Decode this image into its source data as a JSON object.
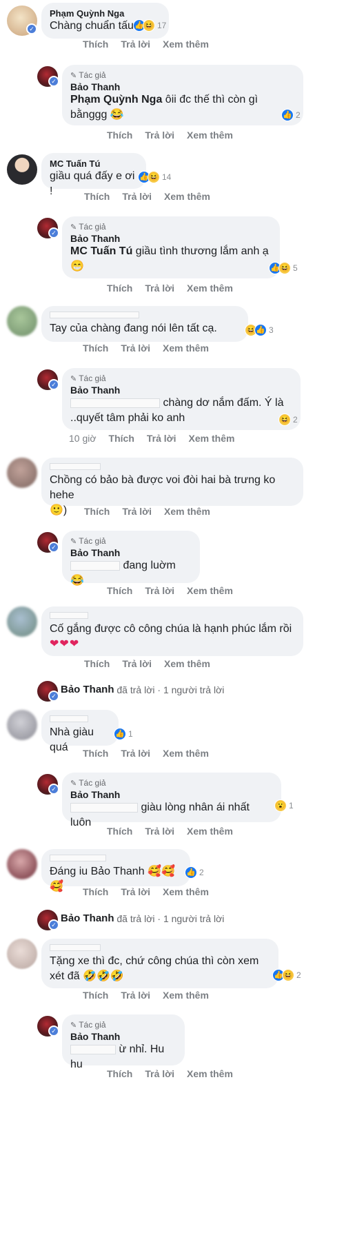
{
  "labels": {
    "like": "Thích",
    "reply": "Trả lời",
    "more": "Xem thêm",
    "author": "Tác giả",
    "replied_suffix": "đã trả lời",
    "one_reply": "1 người trả lời"
  },
  "comments": [
    {
      "name": "Phạm Quỳnh Nga",
      "text": "Chàng chuẩn tấu",
      "react_count": "17"
    },
    {
      "name": "Bảo Thanh",
      "tag": "Phạm Quỳnh Nga",
      "text": " ôii đc thế thì còn gì bằnggg",
      "react_count": "2"
    },
    {
      "name": "MC Tuấn Tú",
      "text": "giầu quá đấy e ơi !",
      "react_count": "14"
    },
    {
      "name": "Bảo Thanh",
      "tag": "MC Tuấn Tú",
      "text": " giầu tình thương lắm anh ạ",
      "react_count": "5"
    },
    {
      "name": "",
      "text": "Tay của chàng đang nói lên tất cạ.",
      "react_count": "3"
    },
    {
      "name": "Bảo Thanh",
      "text": "chàng dơ nắm đấm. Ý là ..quyết tâm phải ko anh",
      "react_count": "2",
      "time": "10 giờ"
    },
    {
      "name": "",
      "text": "Chồng có bảo bà được voi đòi hai bà trưng ko hehe",
      "text2": ")"
    },
    {
      "name": "Bảo Thanh",
      "text": "đang luờm"
    },
    {
      "name": "",
      "text": "Cố gắng được cô công chúa là hạnh phúc lắm rồi"
    },
    {
      "name": "Bảo Thanh"
    },
    {
      "name": "",
      "text": "Nhà giàu quá",
      "react_count": "1"
    },
    {
      "name": "Bảo Thanh",
      "text": "giàu lòng nhân ái nhất luôn",
      "react_count": "1"
    },
    {
      "name": "",
      "text": "Đáng iu Bảo Thanh",
      "react_count": "2"
    },
    {
      "name": "Bảo Thanh"
    },
    {
      "name": "",
      "text": "Tặng xe thì đc, chứ công chúa thì còn xem xét đã",
      "react_count": "2"
    },
    {
      "name": "Bảo Thanh",
      "text": "ừ nhỉ. Hu hu"
    }
  ],
  "colors": {
    "bubble": "#f0f2f5",
    "like_blue": "#1877f2",
    "verified_blue": "#4c7ed9",
    "muted_text": "#8a8d91"
  }
}
